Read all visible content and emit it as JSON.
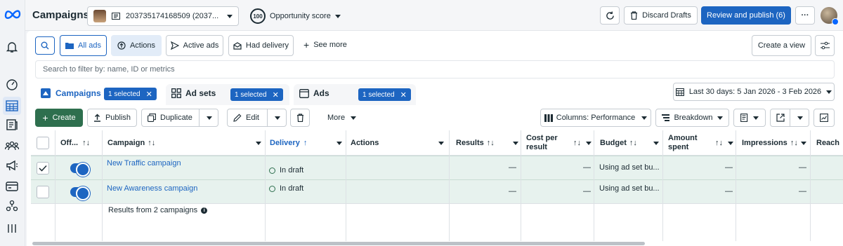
{
  "app": {
    "title": "Campaigns",
    "logo": "meta-logo"
  },
  "topbar": {
    "account_name": "203735174168509 (2037...",
    "score_value": "100",
    "score_label": "Opportunity score",
    "discard_label": "Discard Drafts",
    "publish_label": "Review and publish (6)"
  },
  "filterbar": {
    "all_ads": "All ads",
    "actions": "Actions",
    "active_ads": "Active ads",
    "had_delivery": "Had delivery",
    "see_more": "See more",
    "create_view": "Create a view",
    "search_placeholder": "Search to filter by: name, ID or metrics"
  },
  "tabs": [
    {
      "label": "Campaigns",
      "selected": "1 selected"
    },
    {
      "label": "Ad sets",
      "selected": "1 selected"
    },
    {
      "label": "Ads",
      "selected": "1 selected"
    }
  ],
  "date_range": "Last 30 days: 5 Jan 2026 - 3 Feb 2026",
  "toolbar": {
    "create": "Create",
    "publish": "Publish",
    "duplicate": "Duplicate",
    "edit": "Edit",
    "more": "More",
    "columns": "Columns: Performance",
    "breakdown": "Breakdown"
  },
  "table": {
    "headers": {
      "off": "Off...",
      "campaign": "Campaign",
      "delivery": "Delivery",
      "actions": "Actions",
      "results": "Results",
      "cost_line1": "Cost per",
      "cost_line2": "result",
      "budget": "Budget",
      "amount_line1": "Amount",
      "amount_line2": "spent",
      "impressions": "Impressions",
      "reach": "Reach"
    },
    "rows": [
      {
        "name": "New Traffic campaign",
        "delivery": "In draft",
        "results": "—",
        "cost": "—",
        "budget": "Using ad set bu...",
        "amount": "—",
        "impressions": "—",
        "checked": true
      },
      {
        "name": "New Awareness campaign",
        "delivery": "In draft",
        "results": "—",
        "cost": "—",
        "budget": "Using ad set bu...",
        "amount": "—",
        "impressions": "—",
        "checked": false
      }
    ],
    "footer": "Results from 2 campaigns"
  },
  "colors": {
    "brand_blue": "#1d65c1",
    "selected_row": "#e7f2ee",
    "create_green": "#2e6f4e"
  }
}
